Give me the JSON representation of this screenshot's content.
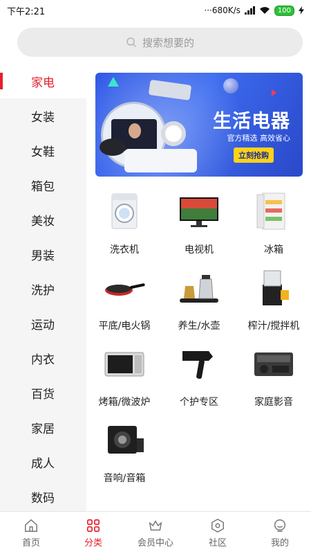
{
  "status": {
    "time": "下午2:21",
    "net": "···680K/s",
    "battery": "100"
  },
  "search": {
    "placeholder": "搜索想要的"
  },
  "sidebar": {
    "items": [
      {
        "label": "家电",
        "active": true
      },
      {
        "label": "女装"
      },
      {
        "label": "女鞋"
      },
      {
        "label": "箱包"
      },
      {
        "label": "美妆"
      },
      {
        "label": "男装"
      },
      {
        "label": "洗护"
      },
      {
        "label": "运动"
      },
      {
        "label": "内衣"
      },
      {
        "label": "百货"
      },
      {
        "label": "家居"
      },
      {
        "label": "成人"
      },
      {
        "label": "数码"
      }
    ]
  },
  "banner": {
    "title": "生活电器",
    "subtitle": "官方精选 高效省心",
    "button": "立刻抢购"
  },
  "categories": [
    {
      "label": "洗衣机",
      "icon": "washing-machine-icon"
    },
    {
      "label": "电视机",
      "icon": "tv-icon"
    },
    {
      "label": "冰箱",
      "icon": "fridge-icon"
    },
    {
      "label": "平底/电火锅",
      "icon": "frying-pan-icon"
    },
    {
      "label": "养生/水壶",
      "icon": "kettle-icon"
    },
    {
      "label": "榨汁/搅拌机",
      "icon": "juicer-icon"
    },
    {
      "label": "烤箱/微波炉",
      "icon": "microwave-icon"
    },
    {
      "label": "个护专区",
      "icon": "hair-dryer-icon"
    },
    {
      "label": "家庭影音",
      "icon": "radio-icon"
    },
    {
      "label": "音响/音箱",
      "icon": "speaker-icon"
    }
  ],
  "nav": {
    "items": [
      {
        "label": "首页",
        "icon": "home-icon"
      },
      {
        "label": "分类",
        "icon": "category-icon",
        "active": true
      },
      {
        "label": "会员中心",
        "icon": "crown-icon"
      },
      {
        "label": "社区",
        "icon": "community-icon"
      },
      {
        "label": "我的",
        "icon": "profile-icon"
      }
    ]
  },
  "colors": {
    "accent": "#e61f2d",
    "sidebar_bg": "#f5f5f5",
    "banner_blue": "#3d6cf0"
  }
}
